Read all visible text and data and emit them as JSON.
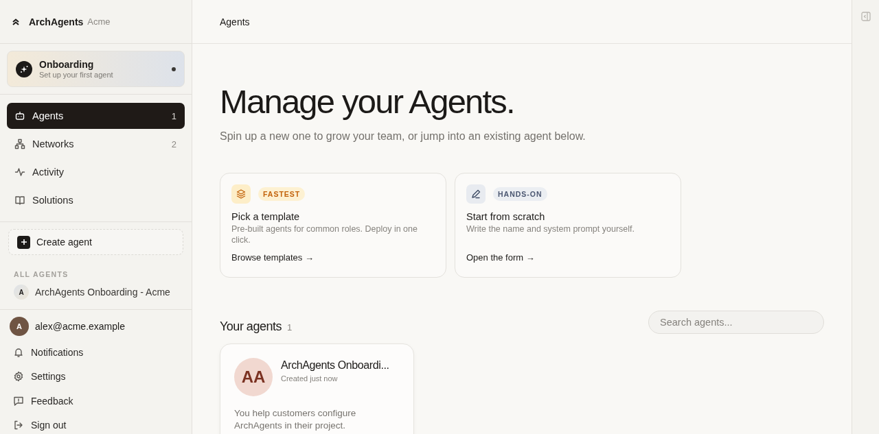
{
  "brand": {
    "name": "ArchAgents",
    "org": "Acme"
  },
  "onboarding": {
    "title": "Onboarding",
    "subtitle": "Set up your first agent",
    "unread": true
  },
  "nav": [
    {
      "kind": "agents",
      "label": "Agents",
      "count": "1",
      "selected": true
    },
    {
      "kind": "networks",
      "label": "Networks",
      "count": "2",
      "selected": false
    },
    {
      "kind": "activity",
      "label": "Activity",
      "selected": false
    },
    {
      "kind": "solutions",
      "label": "Solutions",
      "selected": false
    }
  ],
  "create_button": "Create agent",
  "all_agents": {
    "heading": "ALL AGENTS",
    "items": [
      {
        "initial": "A",
        "name": "ArchAgents Onboarding - Acme"
      }
    ]
  },
  "user": {
    "initial": "A",
    "email": "alex@acme.example"
  },
  "account_menu": [
    {
      "kind": "bell",
      "label": "Notifications"
    },
    {
      "kind": "gear",
      "label": "Settings"
    },
    {
      "kind": "feedback",
      "label": "Feedback"
    },
    {
      "kind": "signout",
      "label": "Sign out"
    }
  ],
  "header": {
    "title": "Agents"
  },
  "hero": {
    "title": "Manage your Agents.",
    "subtitle": "Spin up a new one to grow your team, or jump into an existing agent below."
  },
  "options": [
    {
      "kind": "template",
      "badge": "FASTEST",
      "title": "Pick a template",
      "description": "Pre-built agents for common roles. Deploy in one click.",
      "link": "Browse templates →"
    },
    {
      "kind": "scratch",
      "badge": "HANDS-ON",
      "title": "Start from scratch",
      "description": "Write the name and system prompt yourself.",
      "link": "Open the form →"
    }
  ],
  "agents_section": {
    "title": "Your agents",
    "count": "1",
    "search": {
      "placeholder": "Search agents..."
    }
  },
  "agents": [
    {
      "initials": "AA",
      "name": "ArchAgents Onboardi...",
      "created": "Created just now",
      "description": "You help customers configure ArchAgents in their project."
    }
  ]
}
